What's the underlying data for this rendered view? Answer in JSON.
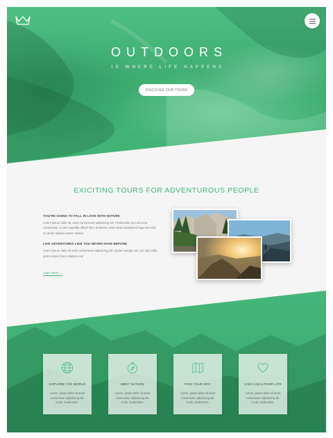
{
  "hero": {
    "title": "OUTDOORS",
    "subtitle": "IS WHERE LIFE HAPPENS",
    "cta_label": "DISCOVER OUR TOURS"
  },
  "section": {
    "title": "EXICITING TOURS FOR ADVENTUROUS PEOPLE",
    "blocks": [
      {
        "heading": "YOU'RE GOING TO FALL IN LOVE WITH NATURE",
        "text": "Lorem ipsum dolor sit, amet consectetur adipisicing elit. Perferendis rum aut error consectetur, a nam expedita officiis illum doloresm animi dicta laudantium fuga est modi et earum adipisci autem soluta!"
      },
      {
        "heading": "LIVE ADVENTURES LIKE YOU NEVER HAVE BEFORE",
        "text": "Lorem ipsum dolor sit amet consectetur adipisicing elit. Quam suscipit non cum ipit nobis optio tempor ibus voluptas eum"
      }
    ],
    "learn_more": "Learn More →"
  },
  "features": [
    {
      "icon": "globe-icon",
      "title": "EXPLORE THE WORLD",
      "text": "Lorem, ipsum dolor sit amet consectetur adipisicing elit. Unde, laudantium."
    },
    {
      "icon": "compass-icon",
      "title": "MEET NATURE",
      "text": "Lorem, ipsum dolor sit amet consectetur adipisicing elit. Unde, laudantium."
    },
    {
      "icon": "map-icon",
      "title": "FIND YOUR WAY",
      "text": "Lorem, ipsum dolor sit amet consectetur adipisicing elit. Unde, laudantium."
    },
    {
      "icon": "heart-icon",
      "title": "LIVE A HEALTHIER LIFE",
      "text": "Lorem, ipsum dolor sit amet consectetur adipisicing elit. Unde, laudantium."
    }
  ],
  "colors": {
    "brand_green": "#3fb37a",
    "hero_green": "#43b476",
    "background": "#f5f5f5"
  }
}
